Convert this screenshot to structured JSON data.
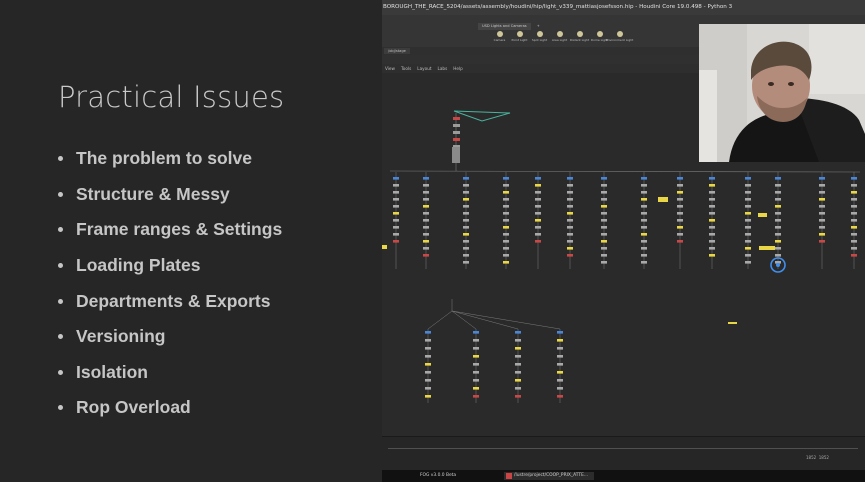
{
  "slide": {
    "title": "Practical Issues",
    "bullets": [
      "The problem to solve",
      "Structure & Messy",
      "Frame ranges & Settings",
      "Loading Plates",
      "Departments & Exports",
      "Versioning",
      "Isolation",
      "Rop Overload"
    ]
  },
  "houdini": {
    "window_title": "BOROUGH_THE_RACE_5204/assets/assembly/houdini/hip/light_v339_mattiasjosefsson.hip - Houdini Core 19.0.498 - Python 3",
    "shelf_tabs": [
      "USD Lights and Cameras",
      "+"
    ],
    "shelf_tools": [
      "Camera",
      "Point Light",
      "Spot Light",
      "Area Light",
      "Distant Light",
      "Dome Light",
      "Environment Light"
    ],
    "pane_tab": "/obj/stage",
    "menu": [
      "View",
      "Tools",
      "Layout",
      "Labs",
      "Help"
    ],
    "timeline": {
      "range_start": "1852",
      "range_end": "1852"
    }
  },
  "taskbar": {
    "items": [
      "FOG v3.0.0 Beta",
      "/lustre/project/COOP_PRIX_ATTE..."
    ]
  },
  "colors": {
    "slide_bg": "#262626",
    "slide_text": "#c6c6c6",
    "node_network_bg": "#2a2a2a",
    "wire": "#7c7c7c",
    "node_yellow": "#e8d646",
    "node_blue": "#4a86d8",
    "node_teal": "#4ab39e",
    "node_red": "#c84848",
    "selection_ring": "#3f8ff0"
  },
  "icons": [
    "shelf-tool-icon",
    "presenter-webcam"
  ]
}
